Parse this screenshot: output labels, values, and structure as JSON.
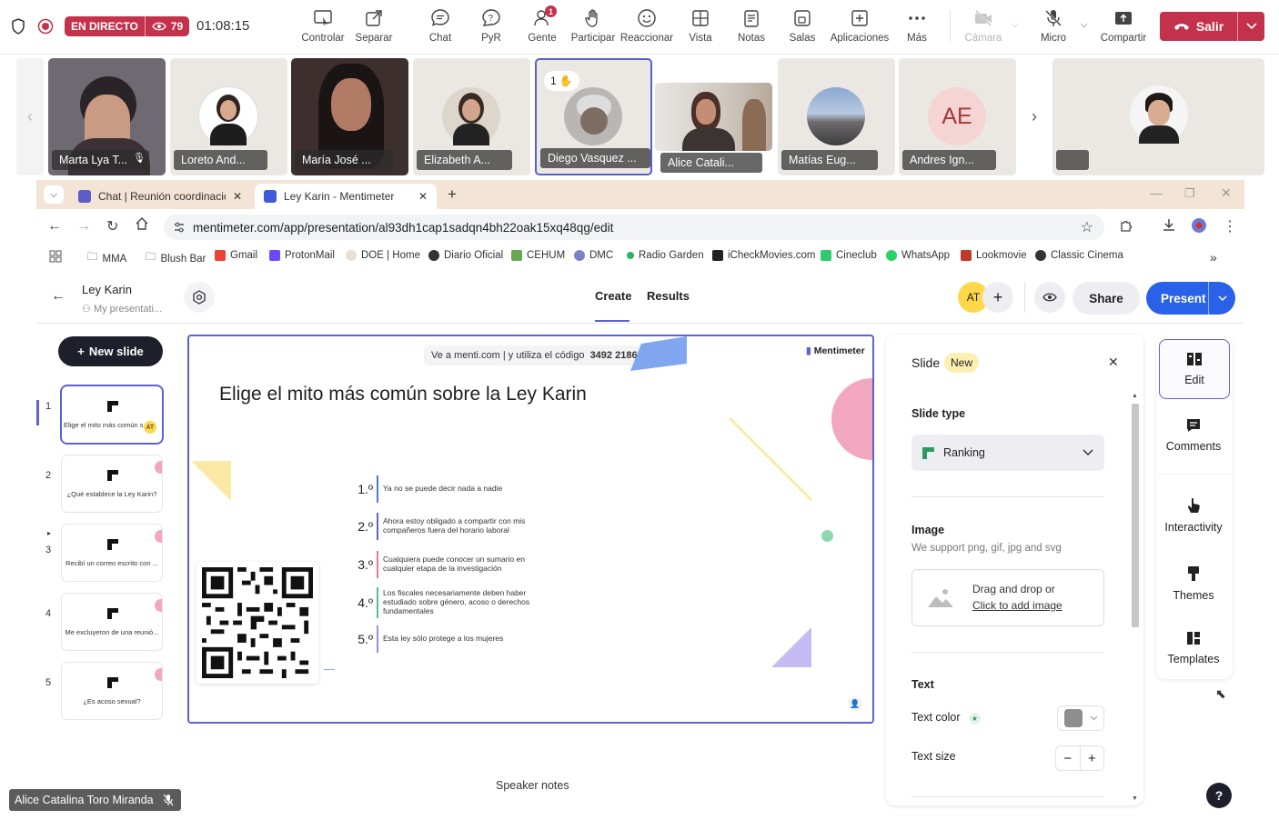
{
  "teams": {
    "live_label": "EN DIRECTO",
    "viewer_count": "79",
    "elapsed": "01:08:15",
    "toolbar": [
      {
        "label": "Controlar",
        "icon": "control-icon"
      },
      {
        "label": "Separar",
        "icon": "pop-out-icon"
      },
      {
        "label": "Chat",
        "icon": "chat-icon"
      },
      {
        "label": "PyR",
        "icon": "qa-icon"
      },
      {
        "label": "Gente",
        "icon": "people-icon"
      },
      {
        "label": "Participar",
        "icon": "raise-hand-icon"
      },
      {
        "label": "Reaccionar",
        "icon": "react-icon"
      },
      {
        "label": "Vista",
        "icon": "view-icon"
      },
      {
        "label": "Notas",
        "icon": "notes-icon"
      },
      {
        "label": "Salas",
        "icon": "rooms-icon"
      },
      {
        "label": "Aplicaciones",
        "icon": "apps-icon"
      },
      {
        "label": "Más",
        "icon": "more-icon"
      },
      {
        "label": "Cámara",
        "icon": "camera-off-icon"
      },
      {
        "label": "Micro",
        "icon": "mic-off-icon"
      },
      {
        "label": "Compartir",
        "icon": "share-icon"
      }
    ],
    "people_badge": "1",
    "leave_label": "Salir"
  },
  "participants": [
    {
      "name": "Marta Lya T...",
      "initials": ""
    },
    {
      "name": "Loreto And...",
      "initials": ""
    },
    {
      "name": "María José ...",
      "initials": ""
    },
    {
      "name": "Elizabeth A...",
      "initials": ""
    },
    {
      "name": "Diego Vasquez ...",
      "initials": "",
      "hand": "1"
    },
    {
      "name": "Alice Catali...",
      "initials": ""
    },
    {
      "name": "Matías Eug...",
      "initials": ""
    },
    {
      "name": "Andres Ign...",
      "initials": "AE"
    }
  ],
  "browser": {
    "tabs": [
      {
        "title": "Chat | Reunión coordinación we"
      },
      {
        "title": "Ley Karin - Mentimeter"
      }
    ],
    "url": "mentimeter.com/app/presentation/al93dh1cap1sadqn4bh22oak15xq48qg/edit",
    "bookmarks": [
      "MMA",
      "Blush Bar",
      "Gmail",
      "ProtonMail",
      "DOE | Home",
      "Diario Oficial",
      "CEHUM",
      "DMC",
      "Radio Garden",
      "iCheckMovies.com",
      "Cineclub",
      "WhatsApp",
      "Lookmovie",
      "Classic Cinema"
    ]
  },
  "menti": {
    "presentation_title": "Ley Karin",
    "breadcrumb": "My presentati...",
    "tab_create": "Create",
    "tab_results": "Results",
    "avatar_initials": "AT",
    "share_label": "Share",
    "present_label": "Present",
    "new_slide_label": "New slide",
    "slides": [
      {
        "num": "1",
        "text": "Elige el mito más común s"
      },
      {
        "num": "2",
        "text": "¿Qué establece la Ley Karin?"
      },
      {
        "num": "3",
        "text": "Recibí un correo escrito con ..."
      },
      {
        "num": "4",
        "text": "Me excluyeron de una reunió..."
      },
      {
        "num": "5",
        "text": "¿Es acoso sexual?"
      }
    ],
    "canvas": {
      "join_text": "Ve a menti.com | y utiliza el código",
      "join_code": "3492 2186",
      "brand": "Mentimeter",
      "title": "Elige el mito más común sobre la Ley Karin",
      "items": [
        {
          "rank": "1.º",
          "text": "Ya no se puede decir nada a nadie",
          "color": "#4a7bd8"
        },
        {
          "rank": "2.º",
          "text": "Ahora estoy obligado a compartir con mis compañeros fuera del horario laboral",
          "color": "#5c61d6"
        },
        {
          "rank": "3.º",
          "text": "Cualquiera puede conocer un sumario en cualquier etapa de la investigación",
          "color": "#e87a9c"
        },
        {
          "rank": "4.º",
          "text": "Los fiscales necesariamente deben haber estudiado sobre género, acoso o derechos fundamentales",
          "color": "#4fbf9f"
        },
        {
          "rank": "5.º",
          "text": "Esta ley sólo protege a los mujeres",
          "color": "#9b8fe0"
        }
      ]
    },
    "speaker_notes": "Speaker notes",
    "panel": {
      "title": "Slide",
      "new_badge": "New",
      "slide_type_label": "Slide type",
      "slide_type_value": "Ranking",
      "image_label": "Image",
      "image_hint": "We support png, gif, jpg and svg",
      "drop_text": "Drag and drop or",
      "drop_link": "Click to add image",
      "text_section": "Text",
      "text_color_label": "Text color",
      "text_size_label": "Text size"
    },
    "side_tools": [
      "Edit",
      "Comments",
      "Interactivity",
      "Themes",
      "Templates"
    ],
    "help": "?"
  },
  "self_view_name": "Alice Catalina Toro Miranda"
}
